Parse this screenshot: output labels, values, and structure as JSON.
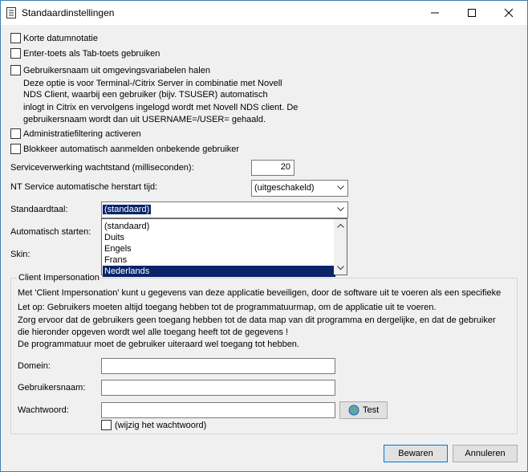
{
  "window": {
    "title": "Standaardinstellingen"
  },
  "checkboxes": {
    "korte_datum": "Korte datumnotatie",
    "enter_tab": "Enter-toets als Tab-toets gebruiken",
    "gebruikersnaam_omgeving": "Gebruikersnaam uit omgevingsvariabelen halen",
    "desc_line1": "Deze optie is voor Terminal-/Citrix Server in combinatie met Novell",
    "desc_line2": "NDS Client, waarbij een gebruiker (bijv. TSUSER) automatisch",
    "desc_line3": "inlogt in Citrix en vervolgens ingelogd wordt met Novell NDS client. De",
    "desc_line4": "gebruikersnaam wordt dan uit USERNAME=/USER= gehaald.",
    "admin_filtering": "Administratiefiltering activeren",
    "blokkeer": "Blokkeer automatisch aanmelden onbekende gebruiker"
  },
  "fields": {
    "wachtstand_label": "Serviceverwerking wachtstand (milliseconden):",
    "wachtstand_value": "20",
    "herstart_label": "NT Service automatische herstart tijd:",
    "herstart_value": "(uitgeschakeld)",
    "taal_label": "Standaardtaal:",
    "taal_value": "(standaard)",
    "taal_options": [
      "(standaard)",
      "Duits",
      "Engels",
      "Frans",
      "Nederlands"
    ],
    "taal_selected_index": 4,
    "auto_start_label": "Automatisch starten:",
    "skin_label": "Skin:"
  },
  "impersonation": {
    "group_title": "Client Impersonation",
    "line1": "Met 'Client Impersonation' kunt u gegevens van deze applicatie beveiligen, door de software uit te voeren als een specifieke",
    "line2": "Let op: Gebruikers moeten altijd toegang hebben tot de programmatuurmap, om de applicatie uit te voeren.",
    "line3": "Zorg ervoor dat de gebruikers geen toegang hebben tot de data map van dit programma en dergelijke, en dat de gebruiker",
    "line4": "die hieronder opgeven wordt wel alle toegang heeft tot de gegevens !",
    "line5": "De programmatuur moet de gebruiker uiteraard wel toegang tot hebben.",
    "domein_label": "Domein:",
    "domein_value": "",
    "gebruiker_label": "Gebruikersnaam:",
    "gebruiker_value": "",
    "wachtwoord_label": "Wachtwoord:",
    "wachtwoord_value": "",
    "test_label": "Test",
    "wijzig_label": "(wijzig het wachtwoord)"
  },
  "buttons": {
    "bewaren": "Bewaren",
    "annuleren": "Annuleren"
  }
}
